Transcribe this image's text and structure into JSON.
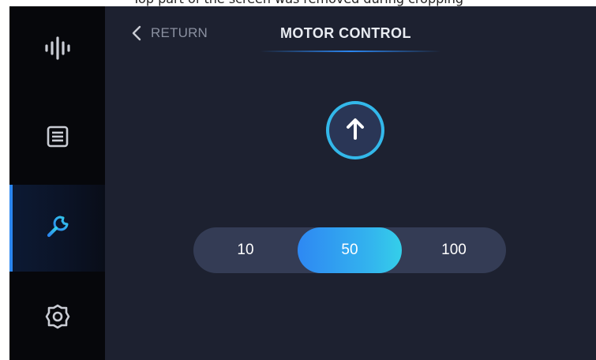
{
  "caption": "Top part of the screen was removed during cropping",
  "sidebar": {
    "items": [
      {
        "icon": "waveform-icon",
        "active": false
      },
      {
        "icon": "list-icon",
        "active": false
      },
      {
        "icon": "wrench-icon",
        "active": true
      },
      {
        "icon": "gear-icon",
        "active": false
      }
    ]
  },
  "header": {
    "return_label": "RETURN",
    "title": "MOTOR CONTROL"
  },
  "control": {
    "up_icon": "arrow-up-icon"
  },
  "speed": {
    "options": [
      "10",
      "50",
      "100"
    ],
    "selected": "50"
  },
  "colors": {
    "accent": "#2b86f0",
    "accent_cyan": "#34cfe9",
    "background": "#1d2130",
    "sidebar": "#06070b"
  }
}
